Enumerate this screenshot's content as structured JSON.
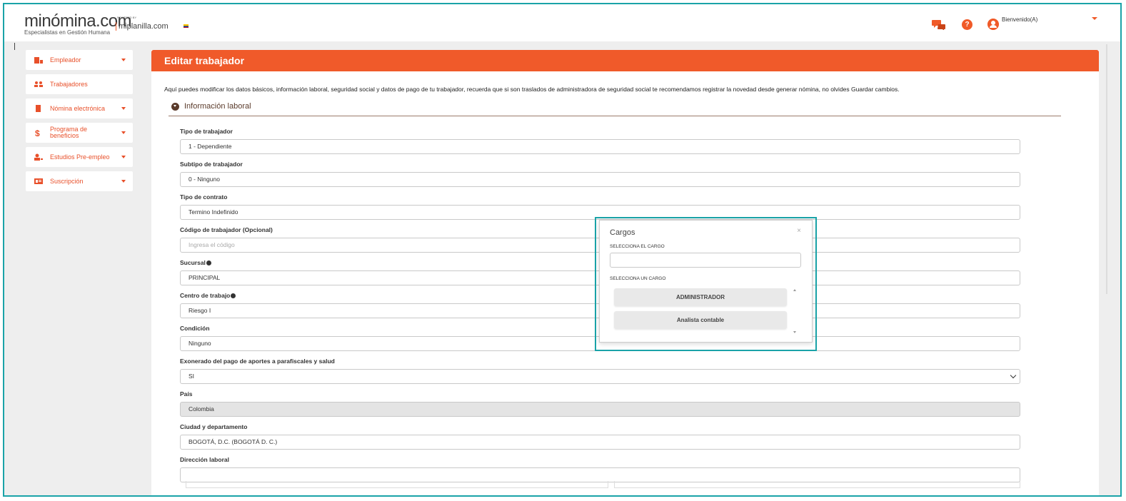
{
  "header": {
    "logo_main": "minómina.com",
    "logo_sub": "Especialistas en Gestión Humana",
    "powered_by": "POWERED BY",
    "partner": "miplanilla.com",
    "welcome": "Bienvenido(A)",
    "help_glyph": "?"
  },
  "sidebar": {
    "items": [
      {
        "label": "Empleador",
        "icon": "building-user-icon"
      },
      {
        "label": "Trabajadores",
        "icon": "users-icon"
      },
      {
        "label": "Nómina electrónica",
        "icon": "file-icon"
      },
      {
        "label": "Programa de beneficios",
        "icon": "dollar-icon"
      },
      {
        "label": "Estudios Pre-empleo",
        "icon": "user-plus-icon"
      },
      {
        "label": "Suscripción",
        "icon": "id-card-icon"
      }
    ]
  },
  "main": {
    "title": "Editar trabajador",
    "intro": "Aquí puedes modificar los datos básicos, información laboral, seguridad social y datos de pago de tu trabajador, recuerda que si son traslados de administradora de seguridad social te recomendamos registrar la novedad desde generar nómina, no olvides Guardar cambios.",
    "section": "Información laboral",
    "fields": [
      {
        "label": "Tipo de trabajador",
        "value": "1 - Dependiente"
      },
      {
        "label": "Subtipo de trabajador",
        "value": "0 - Ninguno"
      },
      {
        "label": "Tipo de contrato",
        "value": "Termino Indefinido"
      },
      {
        "label": "Código de trabajador (Opcional)",
        "placeholder": "Ingresa el código"
      },
      {
        "label": "Sucursal",
        "value": "PRINCIPAL"
      },
      {
        "label": "Centro de trabajo",
        "value": "Riesgo I"
      },
      {
        "label": "Condición",
        "value": "Ninguno"
      },
      {
        "label": "Exonerado del pago de aportes a parafiscales y salud",
        "value": "SI"
      },
      {
        "label": "País",
        "value": "Colombia"
      },
      {
        "label": "Ciudad y departamento",
        "value": "BOGOTÁ, D.C. (BOGOTÁ D. C.)"
      },
      {
        "label": "Dirección laboral",
        "value": ""
      }
    ]
  },
  "modal": {
    "title": "Cargos",
    "close": "×",
    "search_label": "SELECCIONA EL CARGO",
    "list_label": "SELECCIONA UN CARGO",
    "options": [
      "ADMINISTRADOR",
      "Analista contable"
    ]
  },
  "colors": {
    "accent": "#f05a2a",
    "highlight": "#1aa3a8"
  }
}
